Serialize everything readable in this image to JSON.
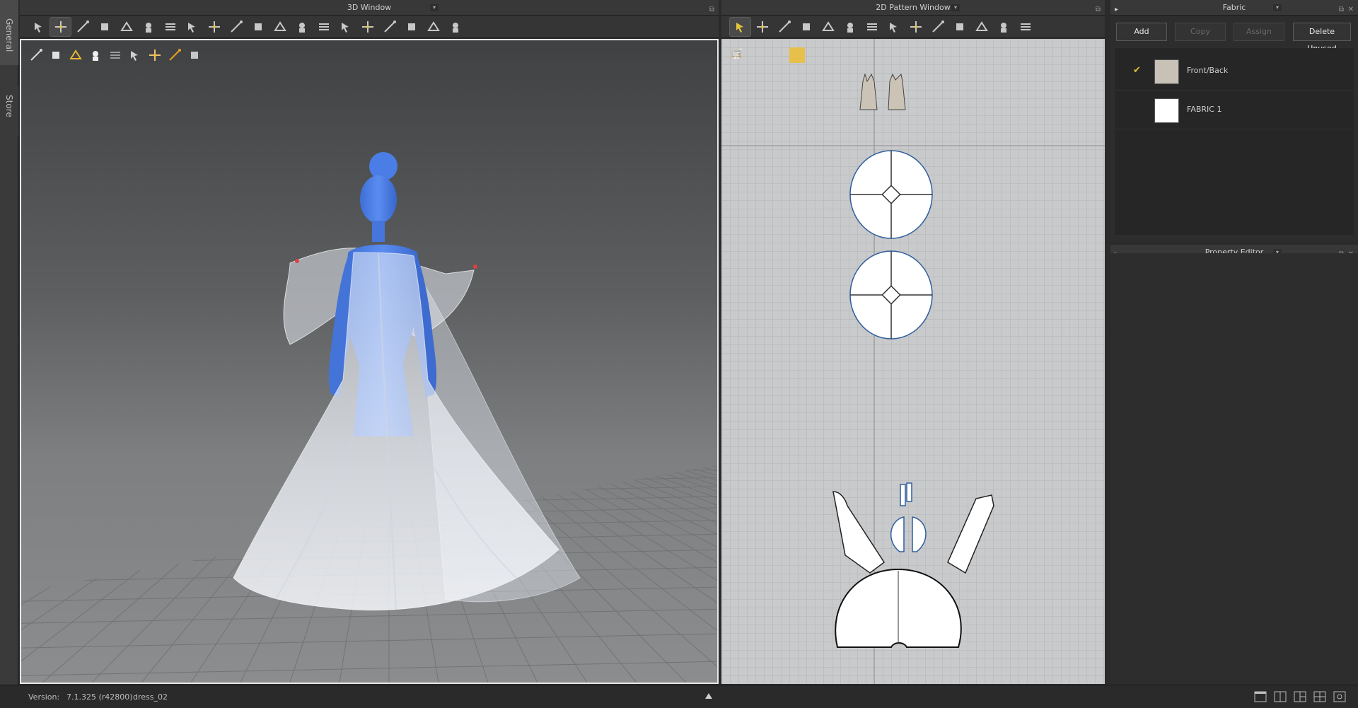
{
  "side_tabs": {
    "general": "General",
    "store": "Store"
  },
  "window3d": {
    "title": "3D Window",
    "toolbar_icons": [
      "select-mesh-icon",
      "move-icon",
      "edit-pin-icon",
      "tack-icon",
      "measure-icon",
      "garment-fit-icon",
      "fold-arrangement-icon",
      "avatar-pose-icon",
      "strengthen-icon",
      "shirring-icon",
      "seam-tape-icon",
      "press-icon",
      "steam-icon",
      "button-icon",
      "zipper-icon",
      "fold-icon",
      "pleat-icon",
      "align-icon",
      "edit-curvature-icon",
      "run-icon"
    ],
    "active_tool": 1,
    "view_tools": [
      "wireframe-icon",
      "shaded-icon",
      "texture-icon",
      "avatar-icon",
      "xray-icon",
      "background-icon",
      "skin-icon",
      "light-icon",
      "floor-icon"
    ]
  },
  "window2d": {
    "title": "2D Pattern Window",
    "toolbar_icons": [
      "select-pattern-icon",
      "edit-point-icon",
      "transform-icon",
      "rectangle-icon",
      "sew-icon",
      "segment-sewing-icon",
      "free-sewing-icon",
      "pin-icon",
      "fold-icon",
      "internal-line-icon",
      "seam-allowance-icon",
      "pleat-icon",
      "line-icon",
      "garment-icon"
    ],
    "active_tool": 0,
    "view_tools": [
      "pattern-outline-icon",
      "mesh-icon",
      "pin-view-icon",
      "fabric-color-icon",
      "lock-icon",
      "pattern-layer-icon"
    ]
  },
  "fabric": {
    "title": "Fabric",
    "buttons": {
      "add": "Add",
      "copy": "Copy",
      "assign": "Assign",
      "delete_unused": "Delete Unused"
    },
    "items": [
      {
        "name": "Front/Back",
        "color": "#c7c1b6",
        "checked": true
      },
      {
        "name": "FABRIC 1",
        "color": "#ffffff",
        "checked": false
      }
    ]
  },
  "property_editor": {
    "title": "Property Editor"
  },
  "status": {
    "version_label": "Version:",
    "version": "7.1.325 (r42800)",
    "file": "dress_02"
  },
  "layout_icons": [
    "single-view-icon",
    "split-view-icon",
    "split-3-view-icon",
    "quad-view-icon",
    "layout-settings-icon"
  ]
}
